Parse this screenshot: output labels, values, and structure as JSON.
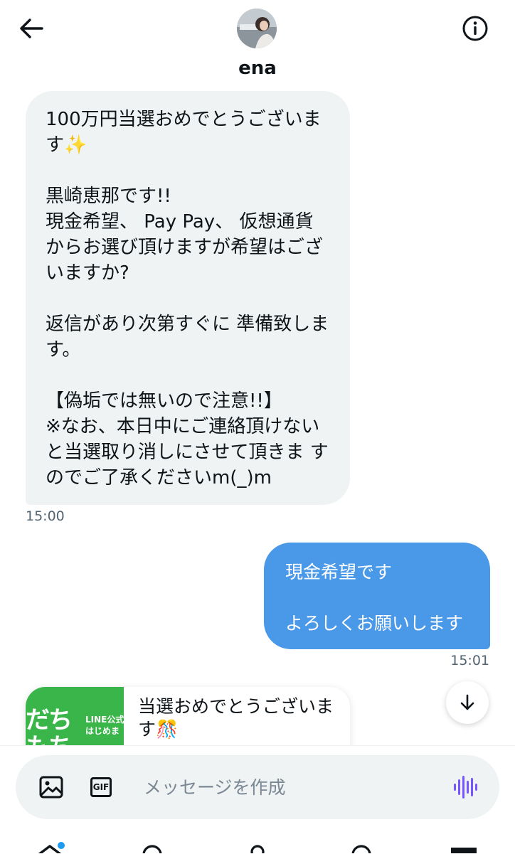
{
  "header": {
    "contact_name": "ena",
    "back_icon": "arrow-left-icon",
    "info_icon": "info-icon"
  },
  "messages": [
    {
      "direction": "received",
      "text": "100万円当選おめでとうございます✨\n\n黒崎恵那です!!\n現金希望、 Pay Pay、 仮想通貨からお選び頂けますが希望はございますか?\n\n返信があり次第すぐに 準備致します。\n\n【偽垢では無いので注意!!】\n※なお、本日中にご連絡頂けないと当選取り消しにさせて頂きま すのでご了承くださいm(_)m",
      "time": "15:00"
    },
    {
      "direction": "sent",
      "text": "現金希望です\n\nよろしくお願いします",
      "time": "15:01"
    }
  ],
  "preview": {
    "thumb_big_text": "だち\nもち",
    "thumb_small_text": "LINE公式\nはじめま",
    "text": "当選おめでとうございます🎊"
  },
  "composer": {
    "placeholder": "メッセージを作成",
    "gif_label": "GIF",
    "image_icon": "image-icon",
    "voice_icon": "voice-waveform-icon"
  },
  "scroll_down_icon": "arrow-down-icon",
  "tabs": [
    "home",
    "search",
    "communities",
    "notifications",
    "messages"
  ],
  "colors": {
    "sent_bubble": "#4a98e8",
    "received_bubble": "#eff3f4",
    "accent": "#1d9bf0",
    "voice": "#7856ff",
    "thumb_green": "#3ab54a"
  }
}
